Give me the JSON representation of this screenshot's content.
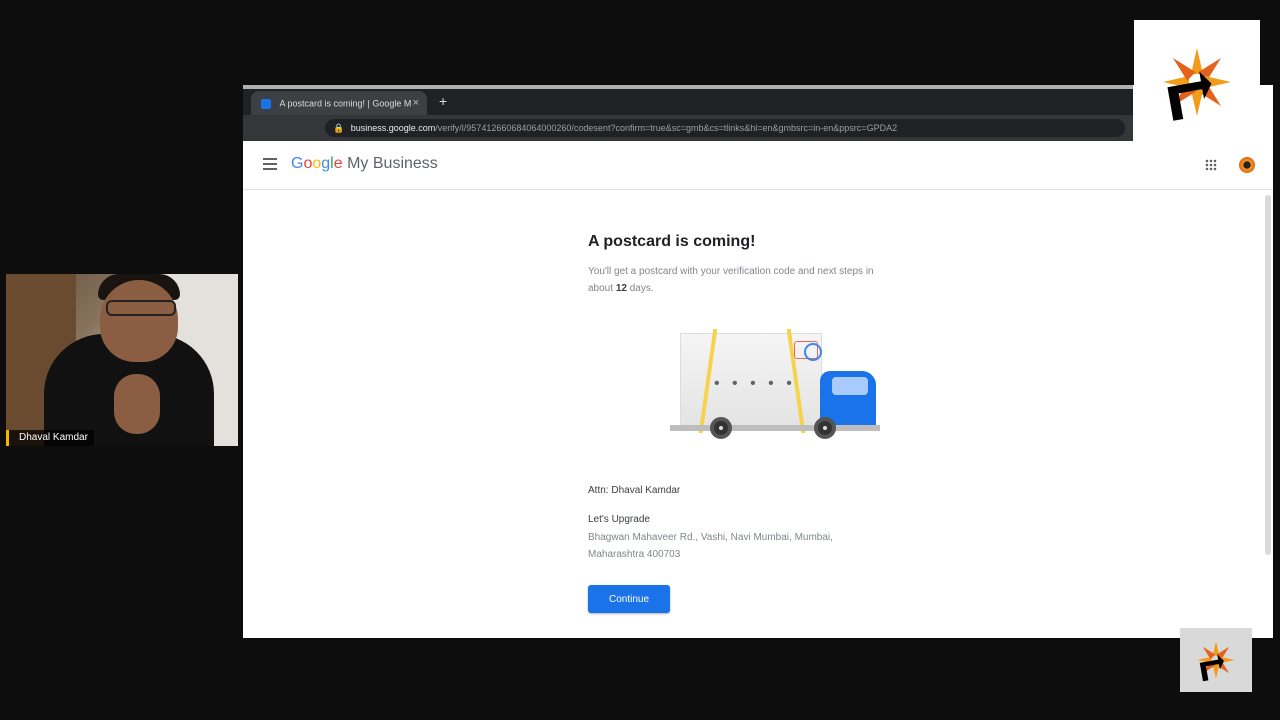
{
  "webcam": {
    "participant_name": "Dhaval Kamdar"
  },
  "browser": {
    "tab_title": "A postcard is coming! | Google M",
    "new_tab_symbol": "+",
    "tab_close_symbol": "×",
    "url_host": "business.google.com",
    "url_path": "/verify/l/957412660684064000260/codesent?confirm=true&sc=gmb&cs=tlinks&hl=en&gmbsrc=in-en&ppsrc=GPDA2"
  },
  "app": {
    "brand_product": "My Business",
    "brand_google_letters": [
      "G",
      "o",
      "o",
      "g",
      "l",
      "e"
    ]
  },
  "main": {
    "title": "A postcard is coming!",
    "desc_prefix": "You'll get a postcard with your verification code and next steps in about",
    "desc_days": "12",
    "desc_suffix": "days.",
    "truck_dots": "• • • • •",
    "attn": "Attn: Dhaval Kamdar",
    "business_name": "Let's Upgrade",
    "address_line1": "Bhagwan Mahaveer Rd., Vashi, Navi Mumbai, Mumbai,",
    "address_line2": "Maharashtra 400703",
    "continue_label": "Continue"
  },
  "colors": {
    "accent": "#1a73e8",
    "logo_orange": "#f29d1a",
    "logo_red": "#e5611c",
    "webcam_name_bar": "#f2b705"
  }
}
